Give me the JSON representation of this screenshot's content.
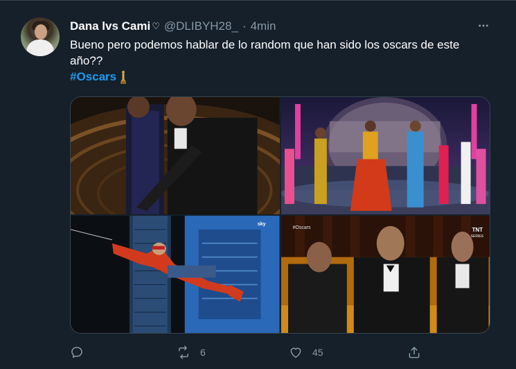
{
  "tweet": {
    "author": {
      "display_name": "Dana lvs Cami",
      "name_symbol": "♡",
      "handle": "@DLIBYH28_",
      "time": "4min"
    },
    "text_line1": "Bueno pero podemos hablar de lo random que han sido los oscars de este",
    "text_line2": "año??",
    "hashtag": "#Oscars",
    "media": [
      {
        "name": "media-photo-slap"
      },
      {
        "name": "media-photo-dance-performance"
      },
      {
        "name": "media-photo-spiderman-stunt",
        "overlay_text": "sky"
      },
      {
        "name": "media-photo-godfather-cast",
        "overlay_left": "#Oscars",
        "overlay_right": "TNT",
        "overlay_sub": "SERIES"
      }
    ],
    "actions": {
      "reply_count": "",
      "retweet_count": "6",
      "like_count": "45"
    }
  },
  "colors": {
    "background": "#15202b",
    "text": "#ffffff",
    "secondary": "#8899a6",
    "link": "#1d9bf0",
    "border": "#38444d"
  }
}
